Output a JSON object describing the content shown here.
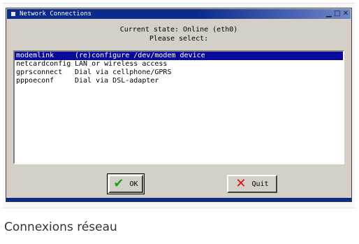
{
  "window": {
    "title": "Network Connections",
    "controls": {
      "minimize": "▁",
      "maximize": "□",
      "close": "✕"
    }
  },
  "header": {
    "line1": "Current state: Online (eth0)",
    "line2": "Please select:"
  },
  "list": {
    "items": [
      {
        "name": "modemlink",
        "desc": "(re)configure /dev/modem device",
        "selected": true
      },
      {
        "name": "netcardconfig",
        "desc": "LAN or wireless access",
        "selected": false
      },
      {
        "name": "gprsconnect",
        "desc": "Dial via cellphone/GPRS",
        "selected": false
      },
      {
        "name": "pppoeconf",
        "desc": "Dial via DSL-adapter",
        "selected": false
      }
    ]
  },
  "buttons": {
    "ok": {
      "label": "OK",
      "icon": "check-icon"
    },
    "quit": {
      "label": "Quit",
      "icon": "cross-icon"
    }
  },
  "caption": "Connexions réseau",
  "colors": {
    "titlebar": "#0a2a8c",
    "selection": "#0a0a9a",
    "dialog_bg": "#d4d0c8"
  }
}
